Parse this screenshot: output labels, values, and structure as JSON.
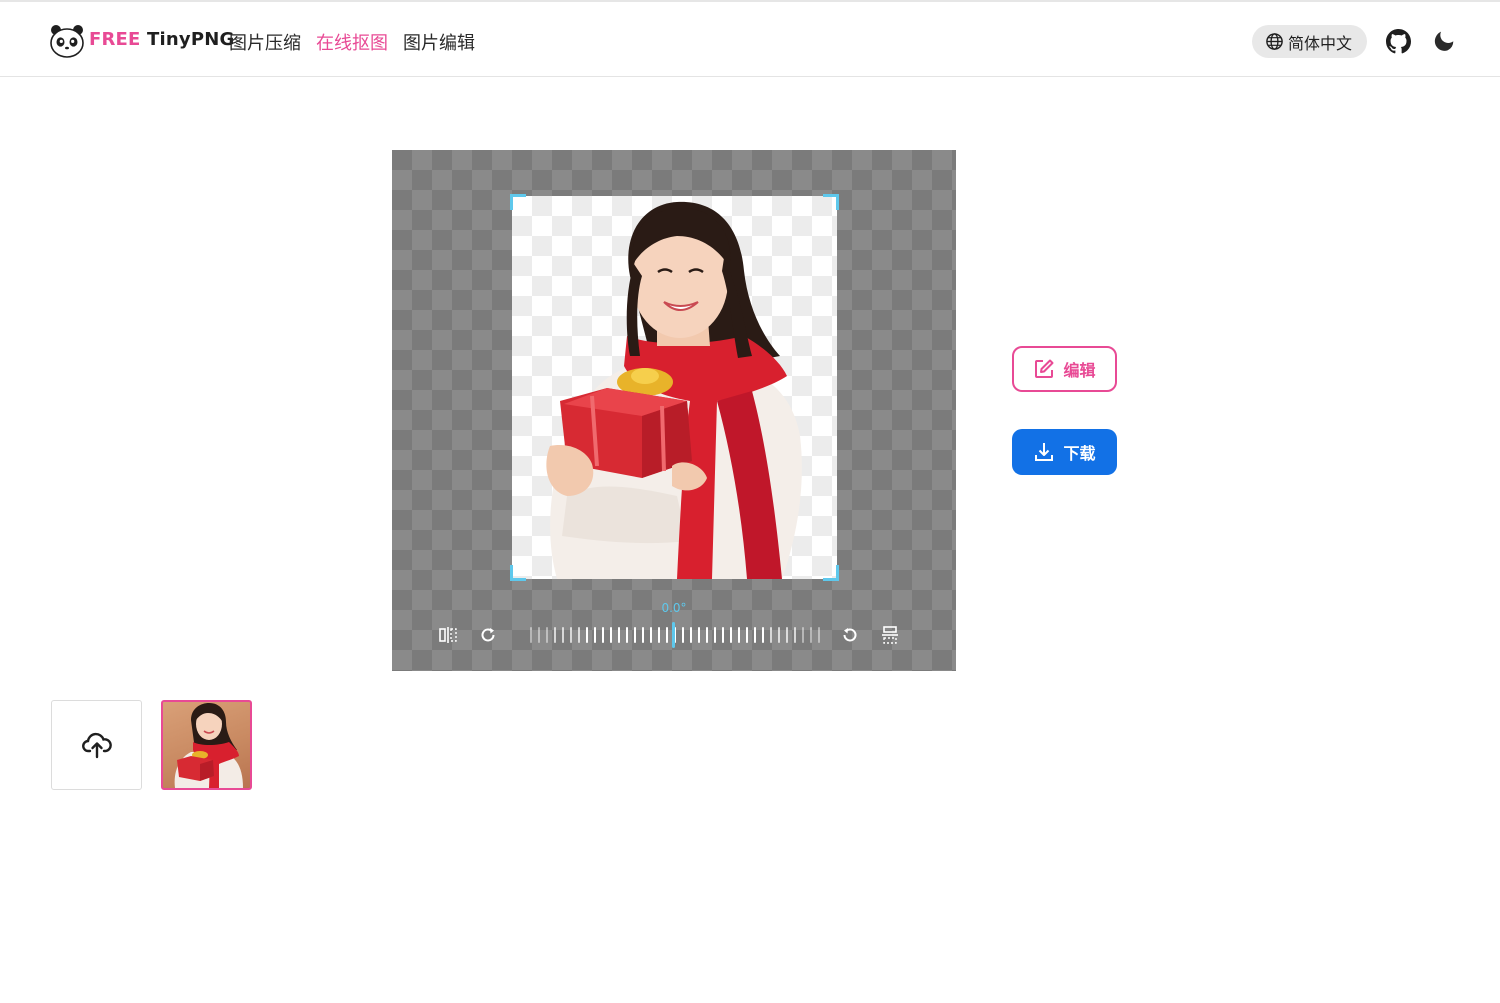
{
  "header": {
    "brand_free": "FREE",
    "brand_name": "TinyPNG",
    "nav": [
      {
        "label": "图片压缩",
        "active": false
      },
      {
        "label": "在线抠图",
        "active": true
      },
      {
        "label": "图片编辑",
        "active": false
      }
    ],
    "language": "简体中文",
    "icons": [
      "panda-logo-icon",
      "globe-icon",
      "github-icon",
      "moon-icon"
    ]
  },
  "editor": {
    "angle_label": "0.0°",
    "rotation_degrees": 0.0,
    "toolbar_icons": [
      "flip-horizontal-icon",
      "rotate-right-icon",
      "rotate-left-icon",
      "flip-vertical-icon"
    ]
  },
  "actions": {
    "edit_label": "编辑",
    "download_label": "下载",
    "edit_icon": "edit-icon",
    "download_icon": "download-icon"
  },
  "thumbnails": {
    "upload_icon": "cloud-upload-icon",
    "selected_index": 0
  },
  "colors": {
    "accent_pink": "#e84a95",
    "primary_blue": "#1271e6",
    "crop_cyan": "#5ec8ec"
  }
}
